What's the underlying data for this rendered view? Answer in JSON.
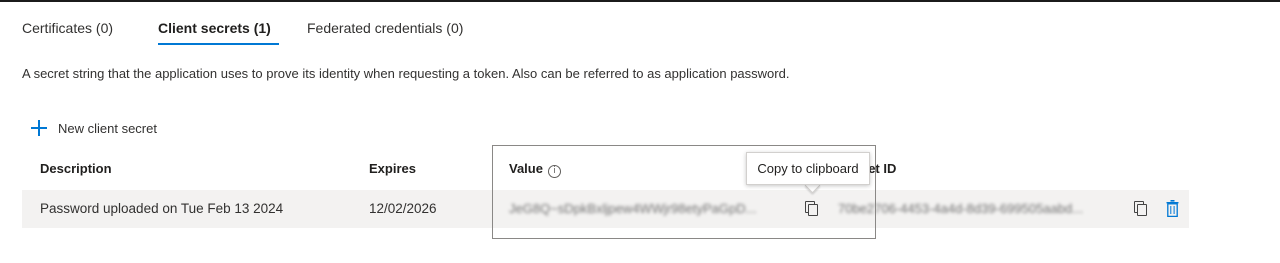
{
  "tabs": [
    {
      "label": "Certificates (0)",
      "active": false
    },
    {
      "label": "Client secrets (1)",
      "active": true
    },
    {
      "label": "Federated credentials (0)",
      "active": false
    }
  ],
  "description": "A secret string that the application uses to prove its identity when requesting a token. Also can be referred to as application password.",
  "new_secret_label": "New client secret",
  "table": {
    "headers": {
      "description": "Description",
      "expires": "Expires",
      "value": "Value",
      "secret_id": "Secret ID"
    },
    "rows": [
      {
        "description": "Password uploaded on Tue Feb 13 2024",
        "expires": "12/02/2026",
        "value": "JeG8Q~sDpkBxljpew4WWjr98etyPaGpD...",
        "secret_id": "70be2706-4453-4a4d-8d39-699505aabd..."
      }
    ]
  },
  "tooltip": "Copy to clipboard",
  "colors": {
    "accent": "#0078d4",
    "row_background": "#f3f2f1",
    "text": "#323130"
  },
  "icons": [
    "plus-icon",
    "info-icon",
    "copy-icon",
    "delete-icon"
  ]
}
